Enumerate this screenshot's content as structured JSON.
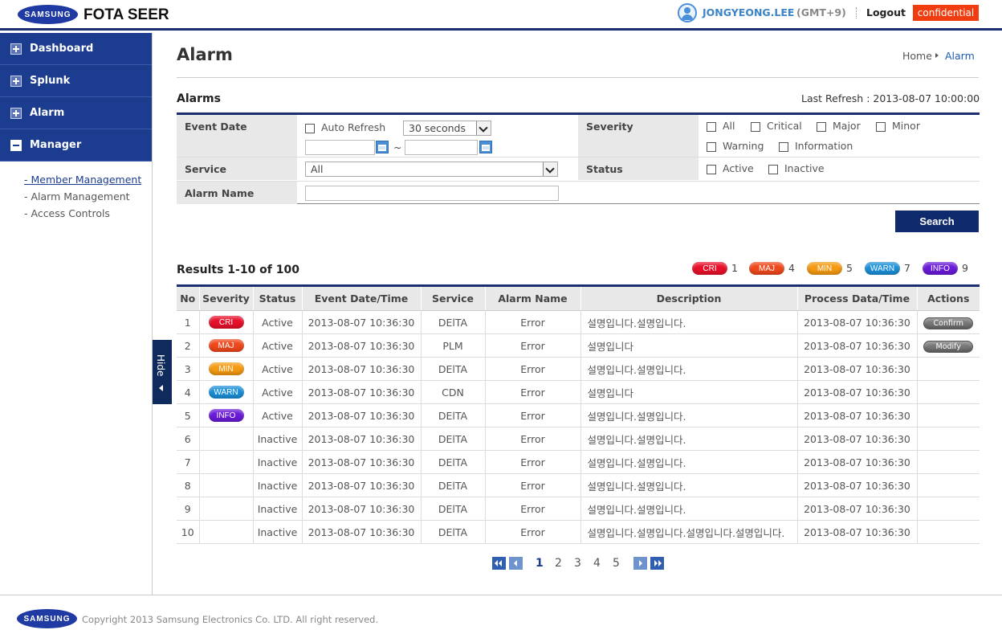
{
  "header": {
    "brand": "SAMSUNG",
    "app_title": "FOTA SEER",
    "user_name": "JONGYEONG.LEE",
    "timezone": "(GMT+9)",
    "logout_label": "Logout",
    "badge": "confidential"
  },
  "sidebar": {
    "items": [
      {
        "label": "Dashboard",
        "icon": "plus-box-icon"
      },
      {
        "label": "Splunk",
        "icon": "plus-box-icon"
      },
      {
        "label": "Alarm",
        "icon": "plus-box-icon"
      },
      {
        "label": "Manager",
        "icon": "minus-box-icon"
      }
    ],
    "subitems": [
      "- Member Management",
      "- Alarm Management",
      "- Access Controls"
    ],
    "hide_label": "Hide"
  },
  "page": {
    "title": "Alarm",
    "breadcrumb": {
      "home": "Home",
      "current": "Alarm"
    },
    "section_title": "Alarms",
    "last_refresh": "Last Refresh : 2013-08-07 10:00:00"
  },
  "filter": {
    "event_date_label": "Event Date",
    "auto_refresh_label": "Auto Refresh",
    "refresh_interval": "30 seconds",
    "date_separator": "~",
    "severity_label": "Severity",
    "severity_options": [
      "All",
      "Critical",
      "Major",
      "Minor",
      "Warning",
      "Information"
    ],
    "service_label": "Service",
    "service_value": "All",
    "status_label": "Status",
    "status_options": [
      "Active",
      "Inactive"
    ],
    "alarm_name_label": "Alarm Name",
    "search_label": "Search"
  },
  "results": {
    "title": "Results 1-10 of 100",
    "legend": [
      {
        "label": "CRI",
        "count": "1",
        "color": "#e8102a"
      },
      {
        "label": "MAJ",
        "count": "4",
        "color": "#f0481c"
      },
      {
        "label": "MIN",
        "count": "5",
        "color": "#f59a12"
      },
      {
        "label": "WARN",
        "count": "7",
        "color": "#1b8fd8"
      },
      {
        "label": "INFO",
        "count": "9",
        "color": "#6a1ad8"
      }
    ],
    "columns": [
      "No",
      "Severity",
      "Status",
      "Event Date/Time",
      "Service",
      "Alarm Name",
      "Description",
      "Process Data/Time",
      "Actions"
    ],
    "rows": [
      {
        "no": "1",
        "severity": "CRI",
        "status": "Active",
        "event_time": "2013-08-07 10:36:30",
        "service": "DElTA",
        "alarm_name": "Error",
        "description": "설명입니다.설명입니다.",
        "process_time": "2013-08-07 10:36:30",
        "action": "Confirm"
      },
      {
        "no": "2",
        "severity": "MAJ",
        "status": "Active",
        "event_time": "2013-08-07 10:36:30",
        "service": "PLM",
        "alarm_name": "Error",
        "description": "설명입니다",
        "process_time": "2013-08-07 10:36:30",
        "action": "Modify"
      },
      {
        "no": "3",
        "severity": "MIN",
        "status": "Active",
        "event_time": "2013-08-07 10:36:30",
        "service": "DElTA",
        "alarm_name": "Error",
        "description": "설명입니다.설명입니다.",
        "process_time": "2013-08-07 10:36:30",
        "action": ""
      },
      {
        "no": "4",
        "severity": "WARN",
        "status": "Active",
        "event_time": "2013-08-07 10:36:30",
        "service": "CDN",
        "alarm_name": "Error",
        "description": "설명입니다",
        "process_time": "2013-08-07 10:36:30",
        "action": ""
      },
      {
        "no": "5",
        "severity": "INFO",
        "status": "Active",
        "event_time": "2013-08-07 10:36:30",
        "service": "DElTA",
        "alarm_name": "Error",
        "description": "설명입니다.설명입니다.",
        "process_time": "2013-08-07 10:36:30",
        "action": ""
      },
      {
        "no": "6",
        "severity": "",
        "status": "Inactive",
        "event_time": "2013-08-07 10:36:30",
        "service": "DElTA",
        "alarm_name": "Error",
        "description": "설명입니다.설명입니다.",
        "process_time": "2013-08-07 10:36:30",
        "action": ""
      },
      {
        "no": "7",
        "severity": "",
        "status": "Inactive",
        "event_time": "2013-08-07 10:36:30",
        "service": "DElTA",
        "alarm_name": "Error",
        "description": "설명입니다.설명입니다.",
        "process_time": "2013-08-07 10:36:30",
        "action": ""
      },
      {
        "no": "8",
        "severity": "",
        "status": "Inactive",
        "event_time": "2013-08-07 10:36:30",
        "service": "DElTA",
        "alarm_name": "Error",
        "description": "설명입니다.설명입니다.",
        "process_time": "2013-08-07 10:36:30",
        "action": ""
      },
      {
        "no": "9",
        "severity": "",
        "status": "Inactive",
        "event_time": "2013-08-07 10:36:30",
        "service": "DElTA",
        "alarm_name": "Error",
        "description": "설명입니다.설명입니다.",
        "process_time": "2013-08-07 10:36:30",
        "action": ""
      },
      {
        "no": "10",
        "severity": "",
        "status": "Inactive",
        "event_time": "2013-08-07 10:36:30",
        "service": "DElTA",
        "alarm_name": "Error",
        "description": "설명입니다.설명입니다.설명입니다.설명입니다.",
        "process_time": "2013-08-07 10:36:30",
        "action": ""
      }
    ]
  },
  "pagination": {
    "pages": [
      "1",
      "2",
      "3",
      "4",
      "5"
    ],
    "current": "1"
  },
  "footer": {
    "brand": "SAMSUNG",
    "copyright": "Copyright 2013 Samsung Electronics Co. LTD. All right reserved."
  }
}
